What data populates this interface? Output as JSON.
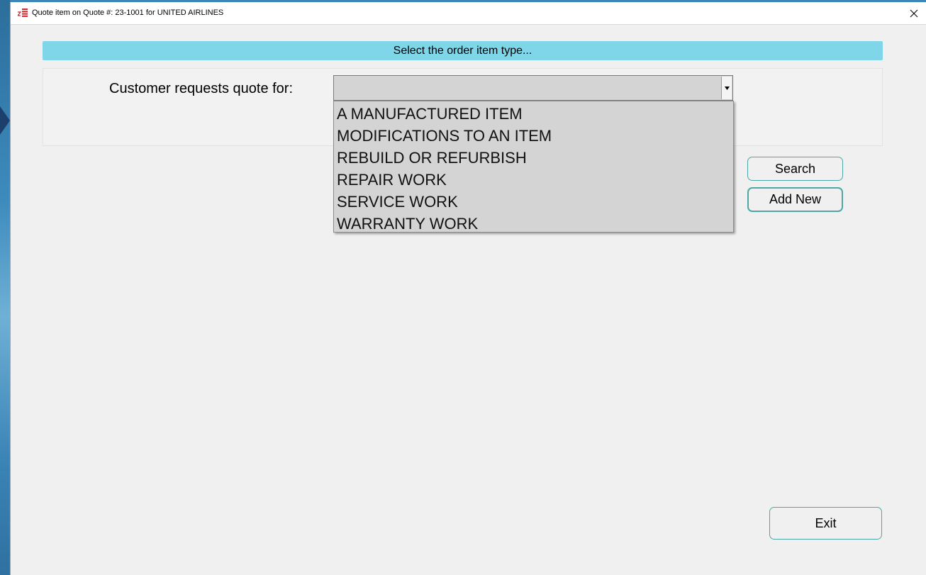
{
  "window": {
    "title": "Quote item on Quote #: 23-1001 for UNITED AIRLINES",
    "close_glyph": "✕"
  },
  "section": {
    "header": "Select the order item type..."
  },
  "form": {
    "label": "Customer requests quote for:",
    "selected_value": "",
    "dropdown_arrow": "▼",
    "options": [
      "A MANUFACTURED ITEM",
      "MODIFICATIONS TO AN ITEM",
      "REBUILD OR REFURBISH",
      "REPAIR WORK",
      "SERVICE WORK",
      "WARRANTY WORK"
    ]
  },
  "buttons": {
    "search": "Search",
    "add_new": "Add New",
    "exit": "Exit"
  },
  "icons": {
    "app": "app-logo-icon",
    "close": "close-icon",
    "dropdown": "chevron-down-icon"
  },
  "colors": {
    "header_bg": "#7fd6e8",
    "button_border": "#4ea7a3",
    "window_bg": "#f0f0f0",
    "dropdown_bg": "#d4d4d4"
  }
}
